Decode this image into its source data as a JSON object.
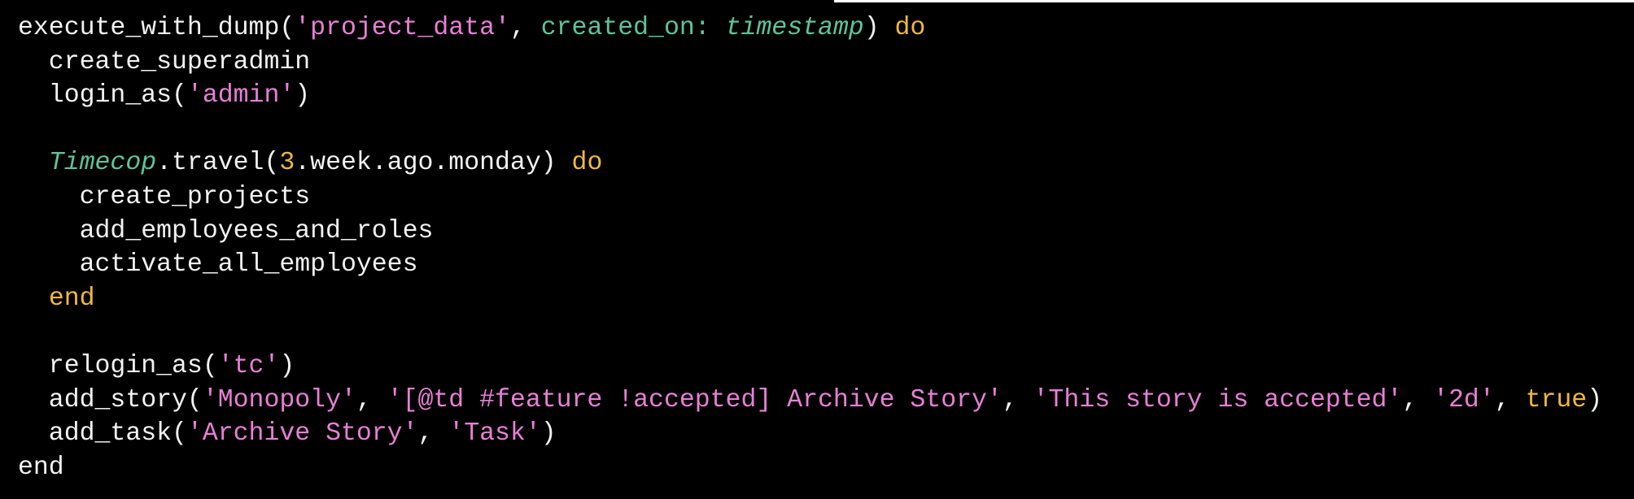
{
  "colors": {
    "background": "#000000",
    "default_text": "#f2f2f2",
    "string": "#e87fd6",
    "keyword": "#f0b840",
    "number": "#f0b840",
    "symbol": "#5fc398",
    "constant": "#5fc398"
  },
  "code": {
    "language": "ruby",
    "lines": [
      [
        {
          "t": "plain",
          "v": "execute_with_dump("
        },
        {
          "t": "str",
          "v": "'project_data'"
        },
        {
          "t": "plain",
          "v": ", "
        },
        {
          "t": "sym",
          "v": "created_on: "
        },
        {
          "t": "ital",
          "v": "timestamp"
        },
        {
          "t": "plain",
          "v": ") "
        },
        {
          "t": "kw",
          "v": "do"
        }
      ],
      [
        {
          "t": "plain",
          "v": "  create_superadmin"
        }
      ],
      [
        {
          "t": "plain",
          "v": "  login_as("
        },
        {
          "t": "str",
          "v": "'admin'"
        },
        {
          "t": "plain",
          "v": ")"
        }
      ],
      [],
      [
        {
          "t": "plain",
          "v": "  "
        },
        {
          "t": "ital",
          "v": "Timecop"
        },
        {
          "t": "plain",
          "v": ".travel("
        },
        {
          "t": "num",
          "v": "3"
        },
        {
          "t": "plain",
          "v": ".week.ago.monday) "
        },
        {
          "t": "kw",
          "v": "do"
        }
      ],
      [
        {
          "t": "plain",
          "v": "    create_projects"
        }
      ],
      [
        {
          "t": "plain",
          "v": "    add_employees_and_roles"
        }
      ],
      [
        {
          "t": "plain",
          "v": "    activate_all_employees"
        }
      ],
      [
        {
          "t": "plain",
          "v": "  "
        },
        {
          "t": "kw",
          "v": "end"
        }
      ],
      [],
      [
        {
          "t": "plain",
          "v": "  relogin_as("
        },
        {
          "t": "str",
          "v": "'tc'"
        },
        {
          "t": "plain",
          "v": ")"
        }
      ],
      [
        {
          "t": "plain",
          "v": "  add_story("
        },
        {
          "t": "str",
          "v": "'Monopoly'"
        },
        {
          "t": "plain",
          "v": ", "
        },
        {
          "t": "str",
          "v": "'[@td #feature !accepted] Archive Story'"
        },
        {
          "t": "plain",
          "v": ", "
        },
        {
          "t": "str",
          "v": "'This story is accepted'"
        },
        {
          "t": "plain",
          "v": ", "
        },
        {
          "t": "str",
          "v": "'2d'"
        },
        {
          "t": "plain",
          "v": ", "
        },
        {
          "t": "kw",
          "v": "true"
        },
        {
          "t": "plain",
          "v": ")"
        }
      ],
      [
        {
          "t": "plain",
          "v": "  add_task("
        },
        {
          "t": "str",
          "v": "'Archive Story'"
        },
        {
          "t": "plain",
          "v": ", "
        },
        {
          "t": "str",
          "v": "'Task'"
        },
        {
          "t": "plain",
          "v": ")"
        }
      ],
      [
        {
          "t": "plain",
          "v": "end"
        }
      ]
    ]
  }
}
